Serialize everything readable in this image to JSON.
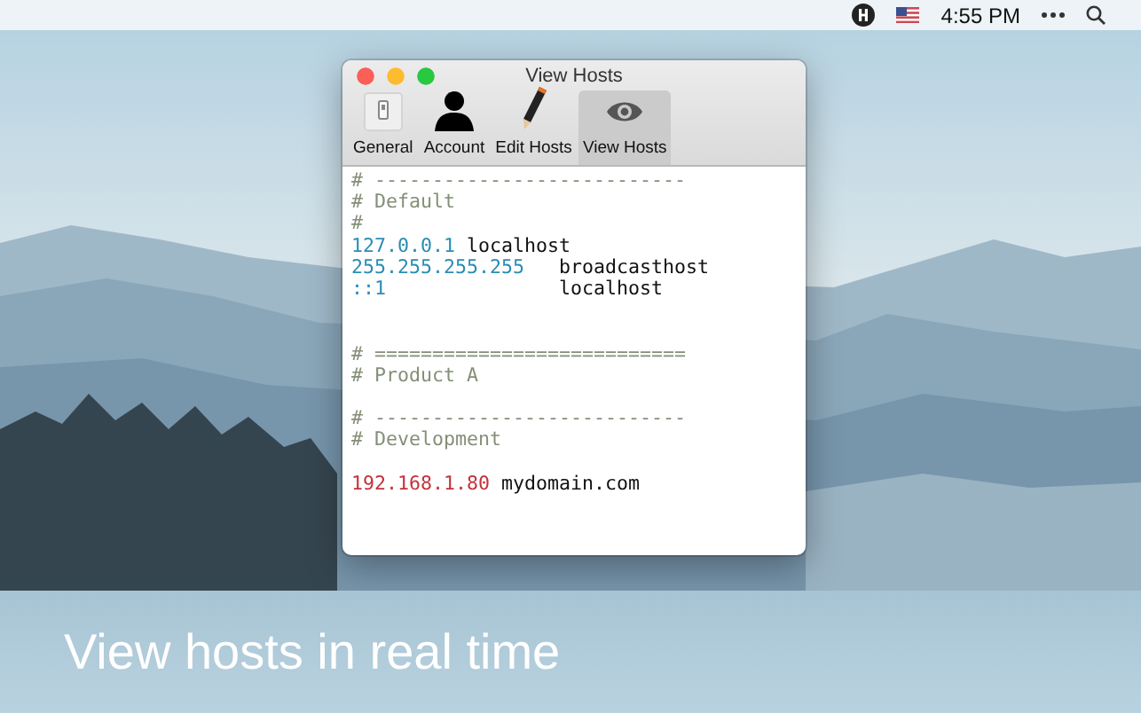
{
  "menu_bar": {
    "time": "4:55 PM"
  },
  "window": {
    "title": "View Hosts",
    "tabs": [
      {
        "label": "General",
        "kind": "switch",
        "selected": false
      },
      {
        "label": "Account",
        "kind": "person",
        "selected": false
      },
      {
        "label": "Edit Hosts",
        "kind": "pencil",
        "selected": false
      },
      {
        "label": "View Hosts",
        "kind": "eye",
        "selected": true
      }
    ]
  },
  "hosts_file": {
    "lines": [
      {
        "kind": "comment",
        "text": "# ---------------------------"
      },
      {
        "kind": "comment",
        "text": "# Default"
      },
      {
        "kind": "comment",
        "text": "#"
      },
      {
        "kind": "entry",
        "ip": "127.0.0.1",
        "host": "localhost",
        "color": "#2b8db3"
      },
      {
        "kind": "column_entry",
        "ip": "255.255.255.255",
        "host": "broadcasthost",
        "color": "#2b8db3"
      },
      {
        "kind": "column_entry",
        "ip": "::1",
        "host": "localhost",
        "color": "#2b8db3"
      },
      {
        "kind": "blank"
      },
      {
        "kind": "blank"
      },
      {
        "kind": "comment",
        "text": "# ==========================="
      },
      {
        "kind": "comment",
        "text": "# Product A"
      },
      {
        "kind": "blank"
      },
      {
        "kind": "comment",
        "text": "# ---------------------------"
      },
      {
        "kind": "comment",
        "text": "# Development"
      },
      {
        "kind": "blank"
      },
      {
        "kind": "entry",
        "ip": "192.168.1.80",
        "host": "mydomain.com",
        "color": "#c5323a"
      }
    ]
  },
  "caption": "View hosts in real time"
}
